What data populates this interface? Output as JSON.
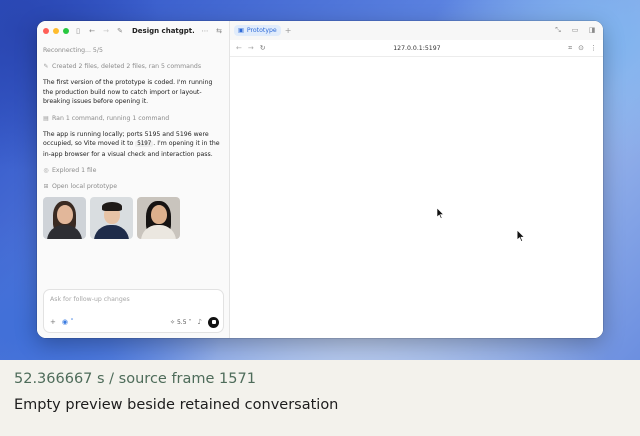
{
  "window": {
    "chat_title": "Design chatgpt...."
  },
  "chat": {
    "status": "Reconnecting... 5/5",
    "action1": "Created 2 files, deleted 2 files, ran 5 commands",
    "message1": "The first version of the prototype is coded. I'm running the production build now to catch import or layout-breaking issues before opening it.",
    "action2": "Ran 1 command, running 1 command",
    "message2_part1": "The app is running locally; ports 5195 and 5196 were occupied, so Vite moved it to ",
    "message2_code": "5197",
    "message2_part2": ". I'm opening it in the in-app browser for a visual check and interaction pass.",
    "action3": "Explored 1 file",
    "action4": "Open local prototype"
  },
  "composer": {
    "placeholder": "Ask for follow-up changes",
    "model": "5.5"
  },
  "browser": {
    "tab_label": "Prototype",
    "url": "127.0.0.1:5197"
  },
  "caption": {
    "timestamp": "52.366667 s / source frame 1571",
    "description": "Empty preview beside retained conversation"
  },
  "colors": {
    "accent": "#2f6bd8",
    "tab_bg": "#e1ecfb"
  }
}
